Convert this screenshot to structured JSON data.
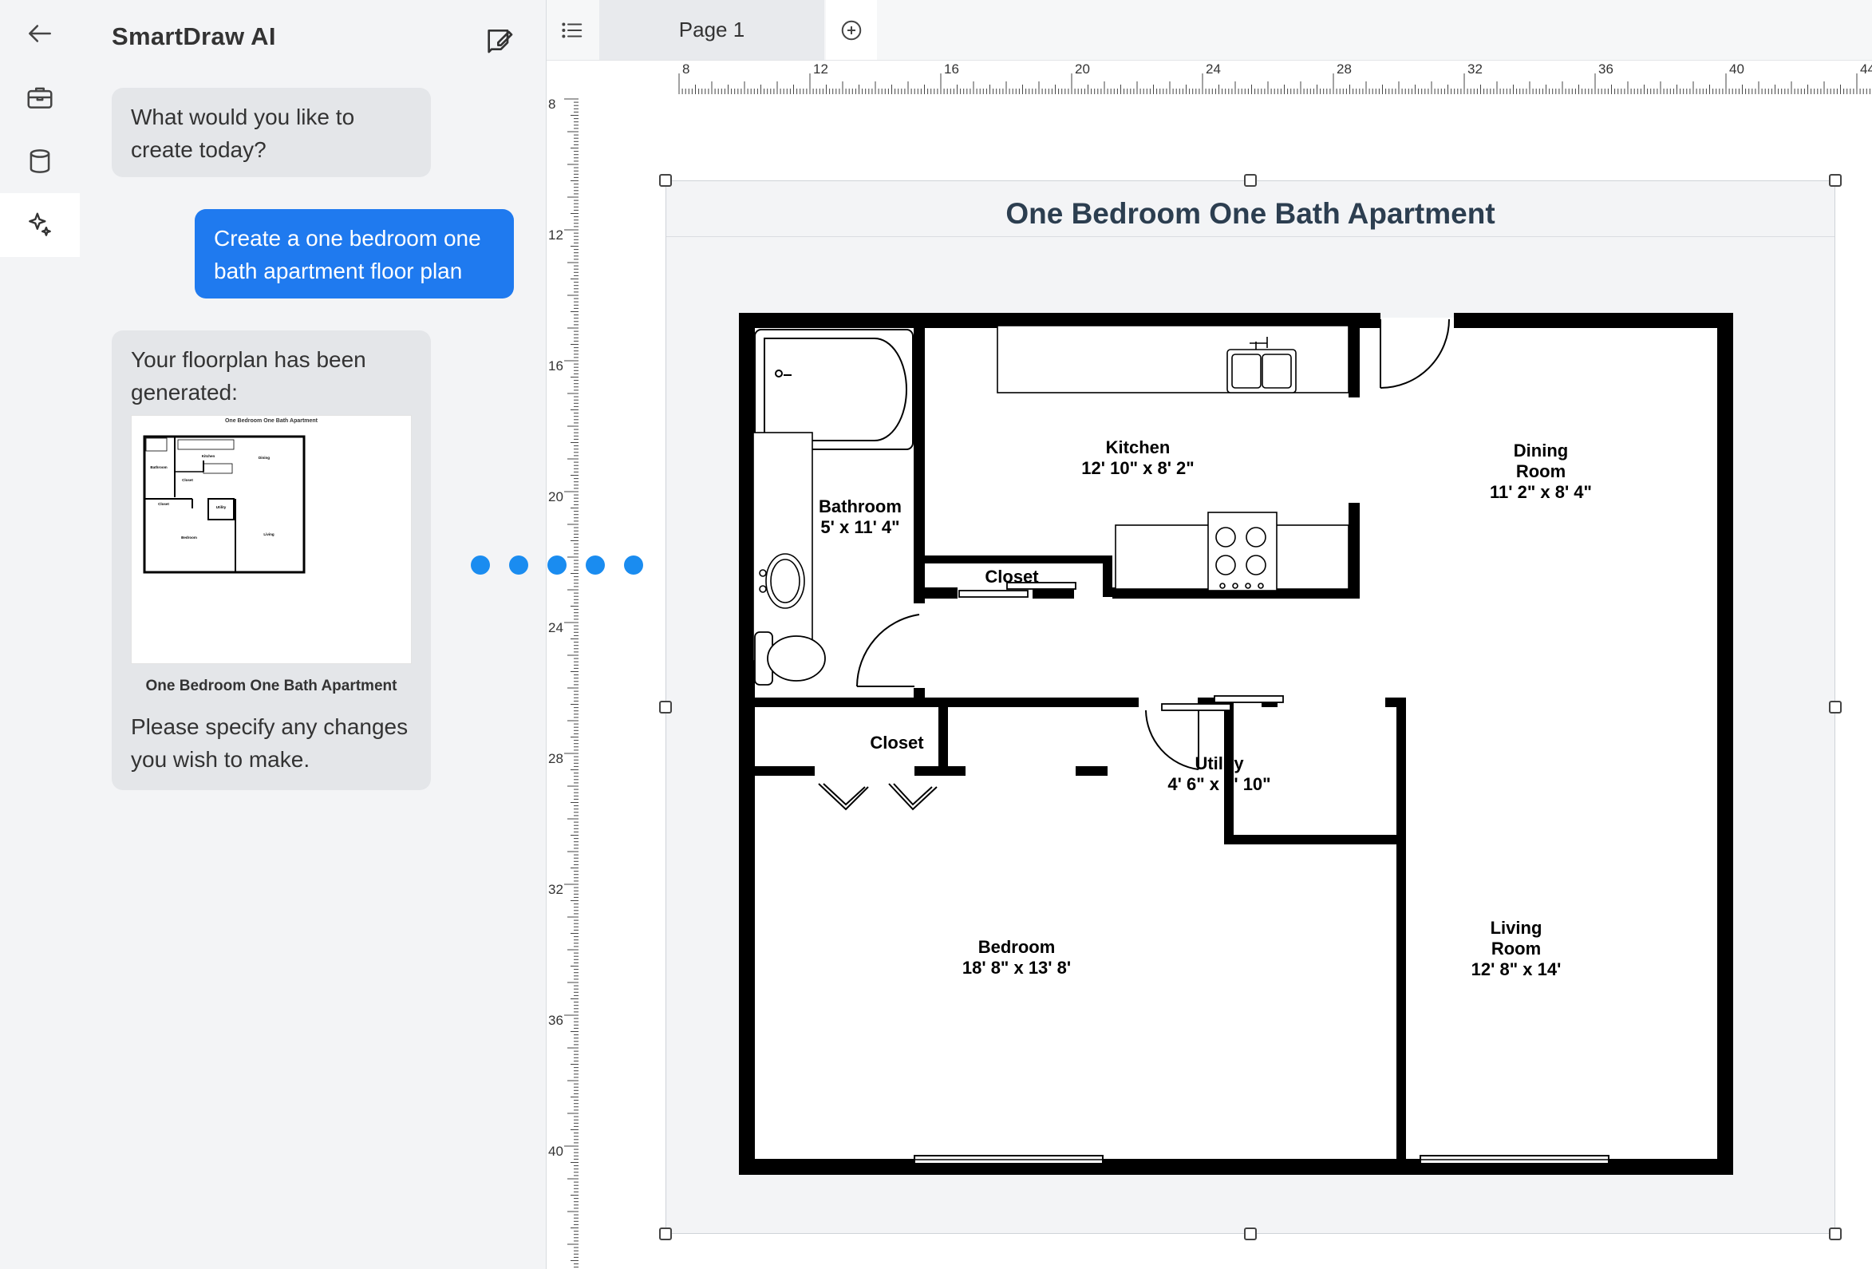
{
  "app": {
    "title": "SmartDraw AI",
    "accent": "#1f7aef"
  },
  "rail": {
    "items": [
      {
        "icon": "arrow-left-icon"
      },
      {
        "icon": "briefcase-icon"
      },
      {
        "icon": "database-icon"
      },
      {
        "icon": "sparkles-icon",
        "active": true
      }
    ]
  },
  "chat": {
    "messages": [
      {
        "role": "assistant",
        "text": "What would you like to create today?"
      },
      {
        "role": "user",
        "text": "Create a one bedroom one bath apartment floor plan"
      },
      {
        "role": "assistant",
        "text": "Your floorplan has been generated:",
        "thumbnail_caption": "One Bedroom One Bath Apartment",
        "followup": "Please specify any changes you wish to make."
      }
    ]
  },
  "tabs": {
    "pages": [
      "Page 1"
    ]
  },
  "rulers": {
    "horizontal": [
      "8",
      "12",
      "16",
      "20",
      "24",
      "28",
      "32",
      "36",
      "40",
      "44"
    ],
    "vertical": [
      "8",
      "12",
      "16",
      "20",
      "24",
      "28",
      "32",
      "36",
      "40"
    ]
  },
  "floorplan": {
    "title": "One Bedroom One Bath Apartment",
    "rooms": {
      "kitchen": {
        "name": "Kitchen",
        "size": "12' 10\" x 8' 2\""
      },
      "dining": {
        "name1": "Dining",
        "name2": "Room",
        "size": "11' 2\" x 8' 4\""
      },
      "bathroom": {
        "name": "Bathroom",
        "size": "5' x 11' 4\""
      },
      "closet_top": {
        "name": "Closet"
      },
      "closet_bed": {
        "name": "Closet"
      },
      "utility": {
        "name": "Utility",
        "size": "4' 6\" x 3' 10\""
      },
      "bedroom": {
        "name": "Bedroom",
        "size": "18' 8\" x 13' 8'"
      },
      "living": {
        "name1": "Living",
        "name2": "Room",
        "size": "12' 8\" x 14'"
      }
    }
  }
}
